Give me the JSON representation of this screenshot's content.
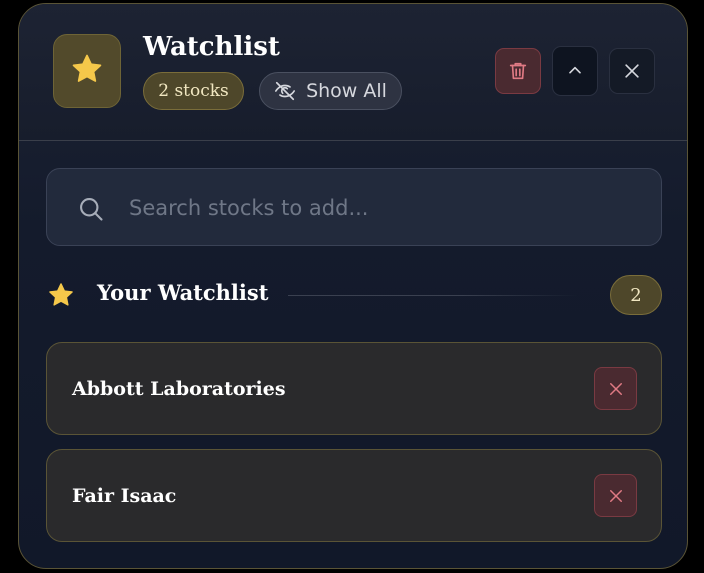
{
  "header": {
    "title": "Watchlist",
    "count_label": "2 stocks",
    "show_all_label": "Show All",
    "icons": {
      "logo": "star-icon",
      "show_all": "eye-off-icon",
      "delete": "trash-icon",
      "collapse": "chevron-up-icon",
      "close": "close-icon"
    }
  },
  "search": {
    "placeholder": "Search stocks to add...",
    "value": ""
  },
  "section": {
    "title": "Your Watchlist",
    "count": "2"
  },
  "stocks": [
    {
      "name": "Abbott Laboratories"
    },
    {
      "name": "Fair Isaac"
    }
  ],
  "colors": {
    "accent_gold": "#f5c84a",
    "danger": "#e07a84",
    "panel_bg": "#141b2c"
  }
}
